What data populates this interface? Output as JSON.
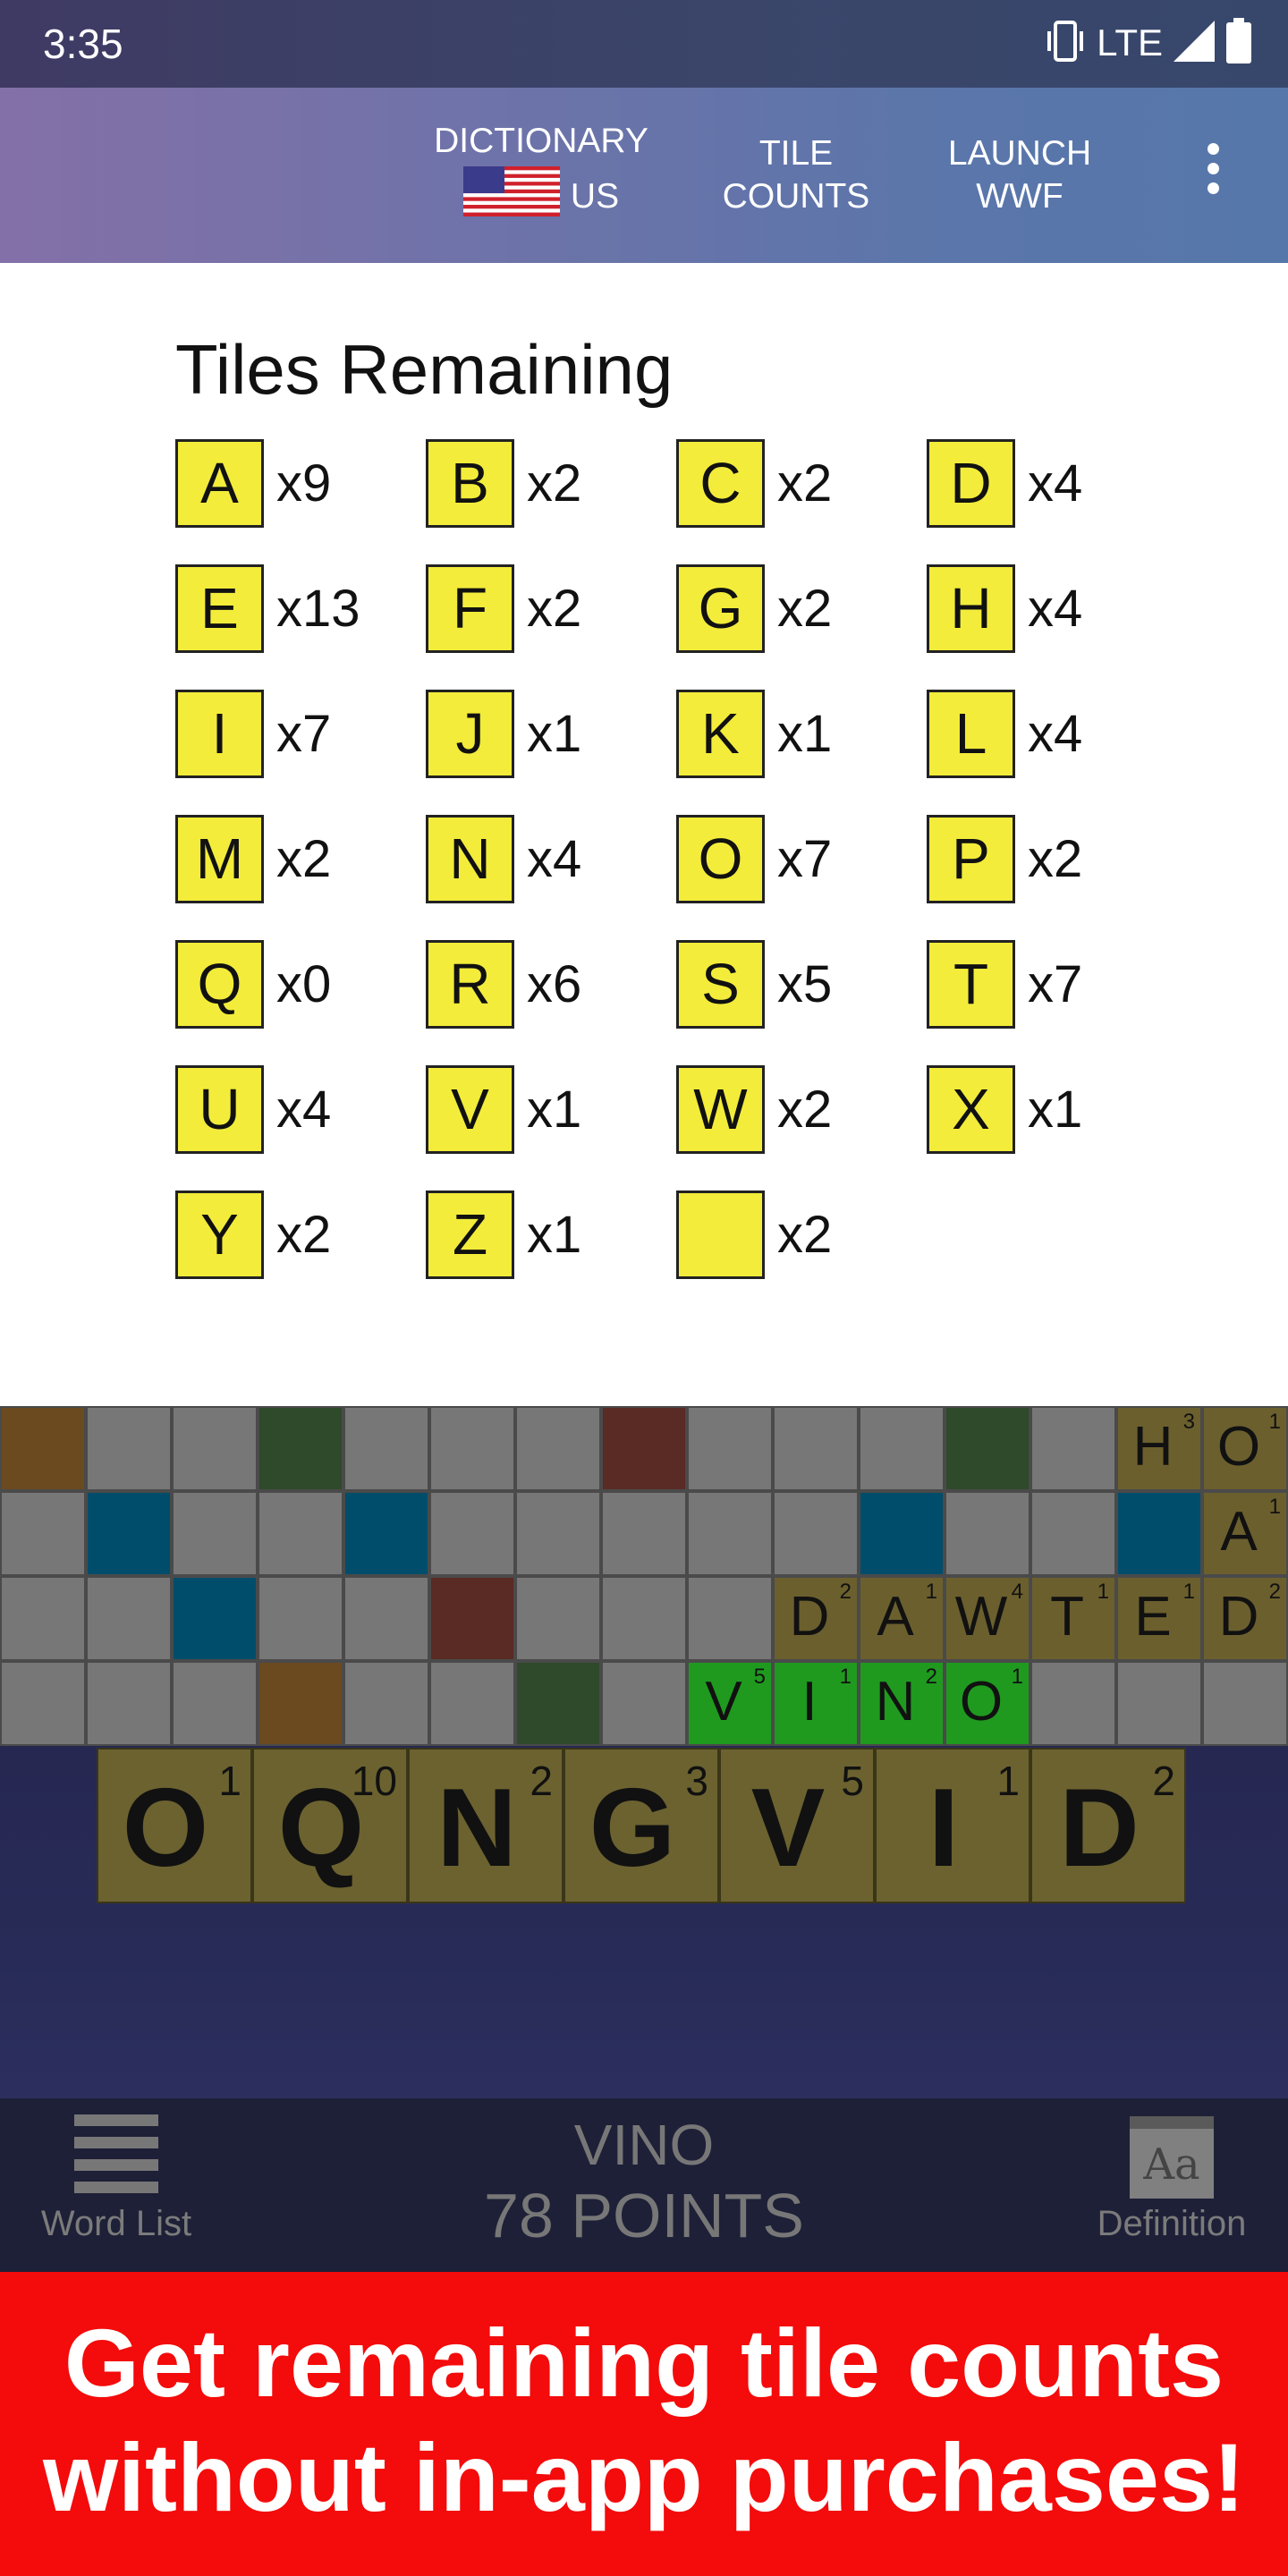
{
  "status_bar": {
    "time": "3:35",
    "network": "LTE",
    "icons": [
      "vibrate-icon",
      "signal-icon",
      "battery-icon"
    ]
  },
  "app_bar": {
    "dictionary_label": "DICTIONARY",
    "dictionary_region": "US",
    "tile_counts_line1": "TILE",
    "tile_counts_line2": "COUNTS",
    "launch_line1": "LAUNCH",
    "launch_line2": "WWF",
    "overflow_icon": "more-vert-icon"
  },
  "tiles_remaining": {
    "title": "Tiles Remaining",
    "tiles": [
      {
        "letter": "A",
        "count": "x9"
      },
      {
        "letter": "B",
        "count": "x2"
      },
      {
        "letter": "C",
        "count": "x2"
      },
      {
        "letter": "D",
        "count": "x4"
      },
      {
        "letter": "E",
        "count": "x13"
      },
      {
        "letter": "F",
        "count": "x2"
      },
      {
        "letter": "G",
        "count": "x2"
      },
      {
        "letter": "H",
        "count": "x4"
      },
      {
        "letter": "I",
        "count": "x7"
      },
      {
        "letter": "J",
        "count": "x1"
      },
      {
        "letter": "K",
        "count": "x1"
      },
      {
        "letter": "L",
        "count": "x4"
      },
      {
        "letter": "M",
        "count": "x2"
      },
      {
        "letter": "N",
        "count": "x4"
      },
      {
        "letter": "O",
        "count": "x7"
      },
      {
        "letter": "P",
        "count": "x2"
      },
      {
        "letter": "Q",
        "count": "x0"
      },
      {
        "letter": "R",
        "count": "x6"
      },
      {
        "letter": "S",
        "count": "x5"
      },
      {
        "letter": "T",
        "count": "x7"
      },
      {
        "letter": "U",
        "count": "x4"
      },
      {
        "letter": "V",
        "count": "x1"
      },
      {
        "letter": "W",
        "count": "x2"
      },
      {
        "letter": "X",
        "count": "x1"
      },
      {
        "letter": "Y",
        "count": "x2"
      },
      {
        "letter": "Z",
        "count": "x1"
      },
      {
        "letter": "",
        "count": "x2"
      }
    ]
  },
  "board": {
    "colors": {
      "empty": "#777777",
      "tile": "#6b5f2e",
      "played": "#1f9a1f",
      "dl": "#004d6b",
      "tl": "#2e4a2a",
      "dw": "#5a2a24",
      "tw": "#6b4a20"
    },
    "rows": [
      [
        {
          "b": "tw"
        },
        {},
        {},
        {
          "b": "tl"
        },
        {},
        {},
        {},
        {
          "b": "dw"
        },
        {},
        {},
        {},
        {
          "b": "tl"
        },
        {},
        {
          "tile": "H",
          "pts": "3"
        },
        {
          "tile": "O",
          "pts": "1"
        }
      ],
      [
        {},
        {
          "b": "dl"
        },
        {},
        {},
        {
          "b": "dl"
        },
        {},
        {},
        {},
        {},
        {},
        {
          "b": "dl"
        },
        {},
        {},
        {
          "b": "dl"
        },
        {
          "tile": "A",
          "pts": "1"
        }
      ],
      [
        {},
        {},
        {
          "b": "dl"
        },
        {},
        {},
        {
          "b": "dw"
        },
        {},
        {},
        {},
        {
          "tile": "D",
          "pts": "2"
        },
        {
          "tile": "A",
          "pts": "1"
        },
        {
          "tile": "W",
          "pts": "4"
        },
        {
          "tile": "T",
          "pts": "1"
        },
        {
          "tile": "E",
          "pts": "1"
        },
        {
          "tile": "D",
          "pts": "2"
        }
      ],
      [
        {},
        {},
        {},
        {
          "b": "tw"
        },
        {},
        {},
        {
          "b": "tl"
        },
        {},
        {
          "tile": "V",
          "pts": "5",
          "played": true
        },
        {
          "tile": "I",
          "pts": "1",
          "played": true
        },
        {
          "tile": "N",
          "pts": "2",
          "played": true
        },
        {
          "tile": "O",
          "pts": "1",
          "played": true
        },
        {},
        {},
        {}
      ]
    ]
  },
  "rack": [
    {
      "letter": "O",
      "pts": "1"
    },
    {
      "letter": "Q",
      "pts": "10"
    },
    {
      "letter": "N",
      "pts": "2"
    },
    {
      "letter": "G",
      "pts": "3"
    },
    {
      "letter": "V",
      "pts": "5"
    },
    {
      "letter": "I",
      "pts": "1"
    },
    {
      "letter": "D",
      "pts": "2"
    }
  ],
  "bottom_nav": {
    "word_list_label": "Word List",
    "word": "VINO",
    "points": "78 POINTS",
    "definition_label": "Definition",
    "definition_icon_text": "Aa"
  },
  "promo": {
    "line1": "Get remaining tile counts",
    "line2": "without in-app purchases!"
  }
}
